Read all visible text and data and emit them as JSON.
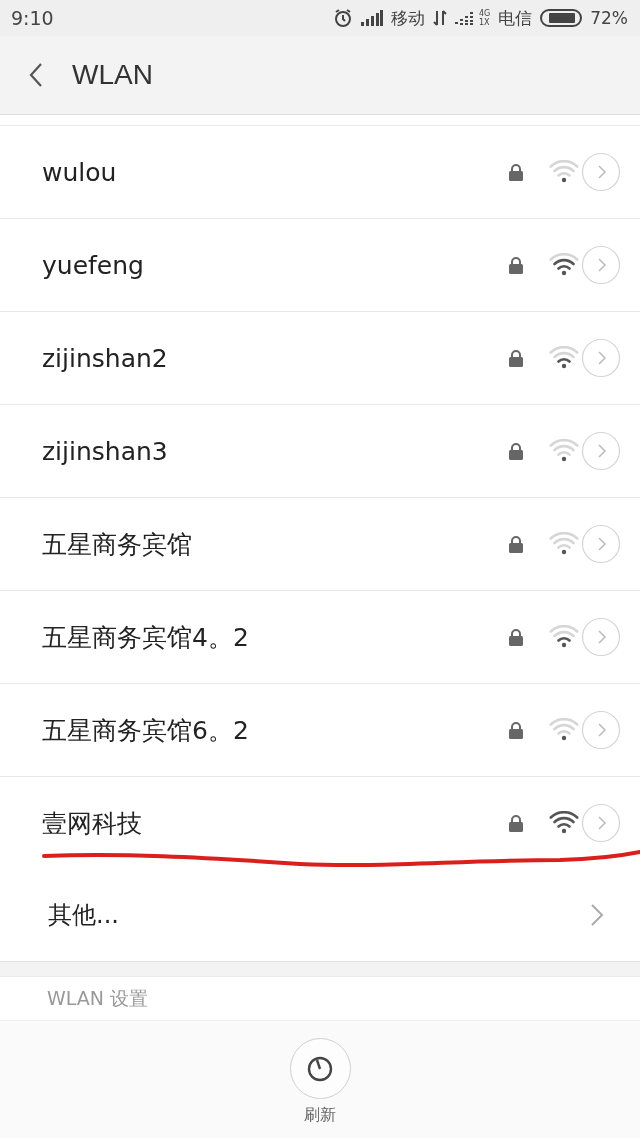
{
  "status_bar": {
    "time": "9:10",
    "carrier_1": "移动",
    "carrier_2": "电信",
    "network_badge_top": "4G",
    "network_badge_bottom": "1X",
    "battery_text": "72%"
  },
  "header": {
    "title": "WLAN"
  },
  "networks": [
    {
      "name": "wulou",
      "locked": true,
      "kind": "weak"
    },
    {
      "name": "yuefeng",
      "locked": true,
      "kind": "good"
    },
    {
      "name": "zijinshan2",
      "locked": true,
      "kind": "fair"
    },
    {
      "name": "zijinshan3",
      "locked": true,
      "kind": "weak"
    },
    {
      "name": "五星商务宾馆",
      "locked": true,
      "kind": "weak"
    },
    {
      "name": "五星商务宾馆4。2",
      "locked": true,
      "kind": "fair"
    },
    {
      "name": "五星商务宾馆6。2",
      "locked": true,
      "kind": "weak"
    },
    {
      "name": "壹网科技",
      "locked": true,
      "kind": "strong"
    }
  ],
  "other": {
    "label": "其他..."
  },
  "section_header": "WLAN 设置",
  "refresh": {
    "label": "刷新"
  }
}
